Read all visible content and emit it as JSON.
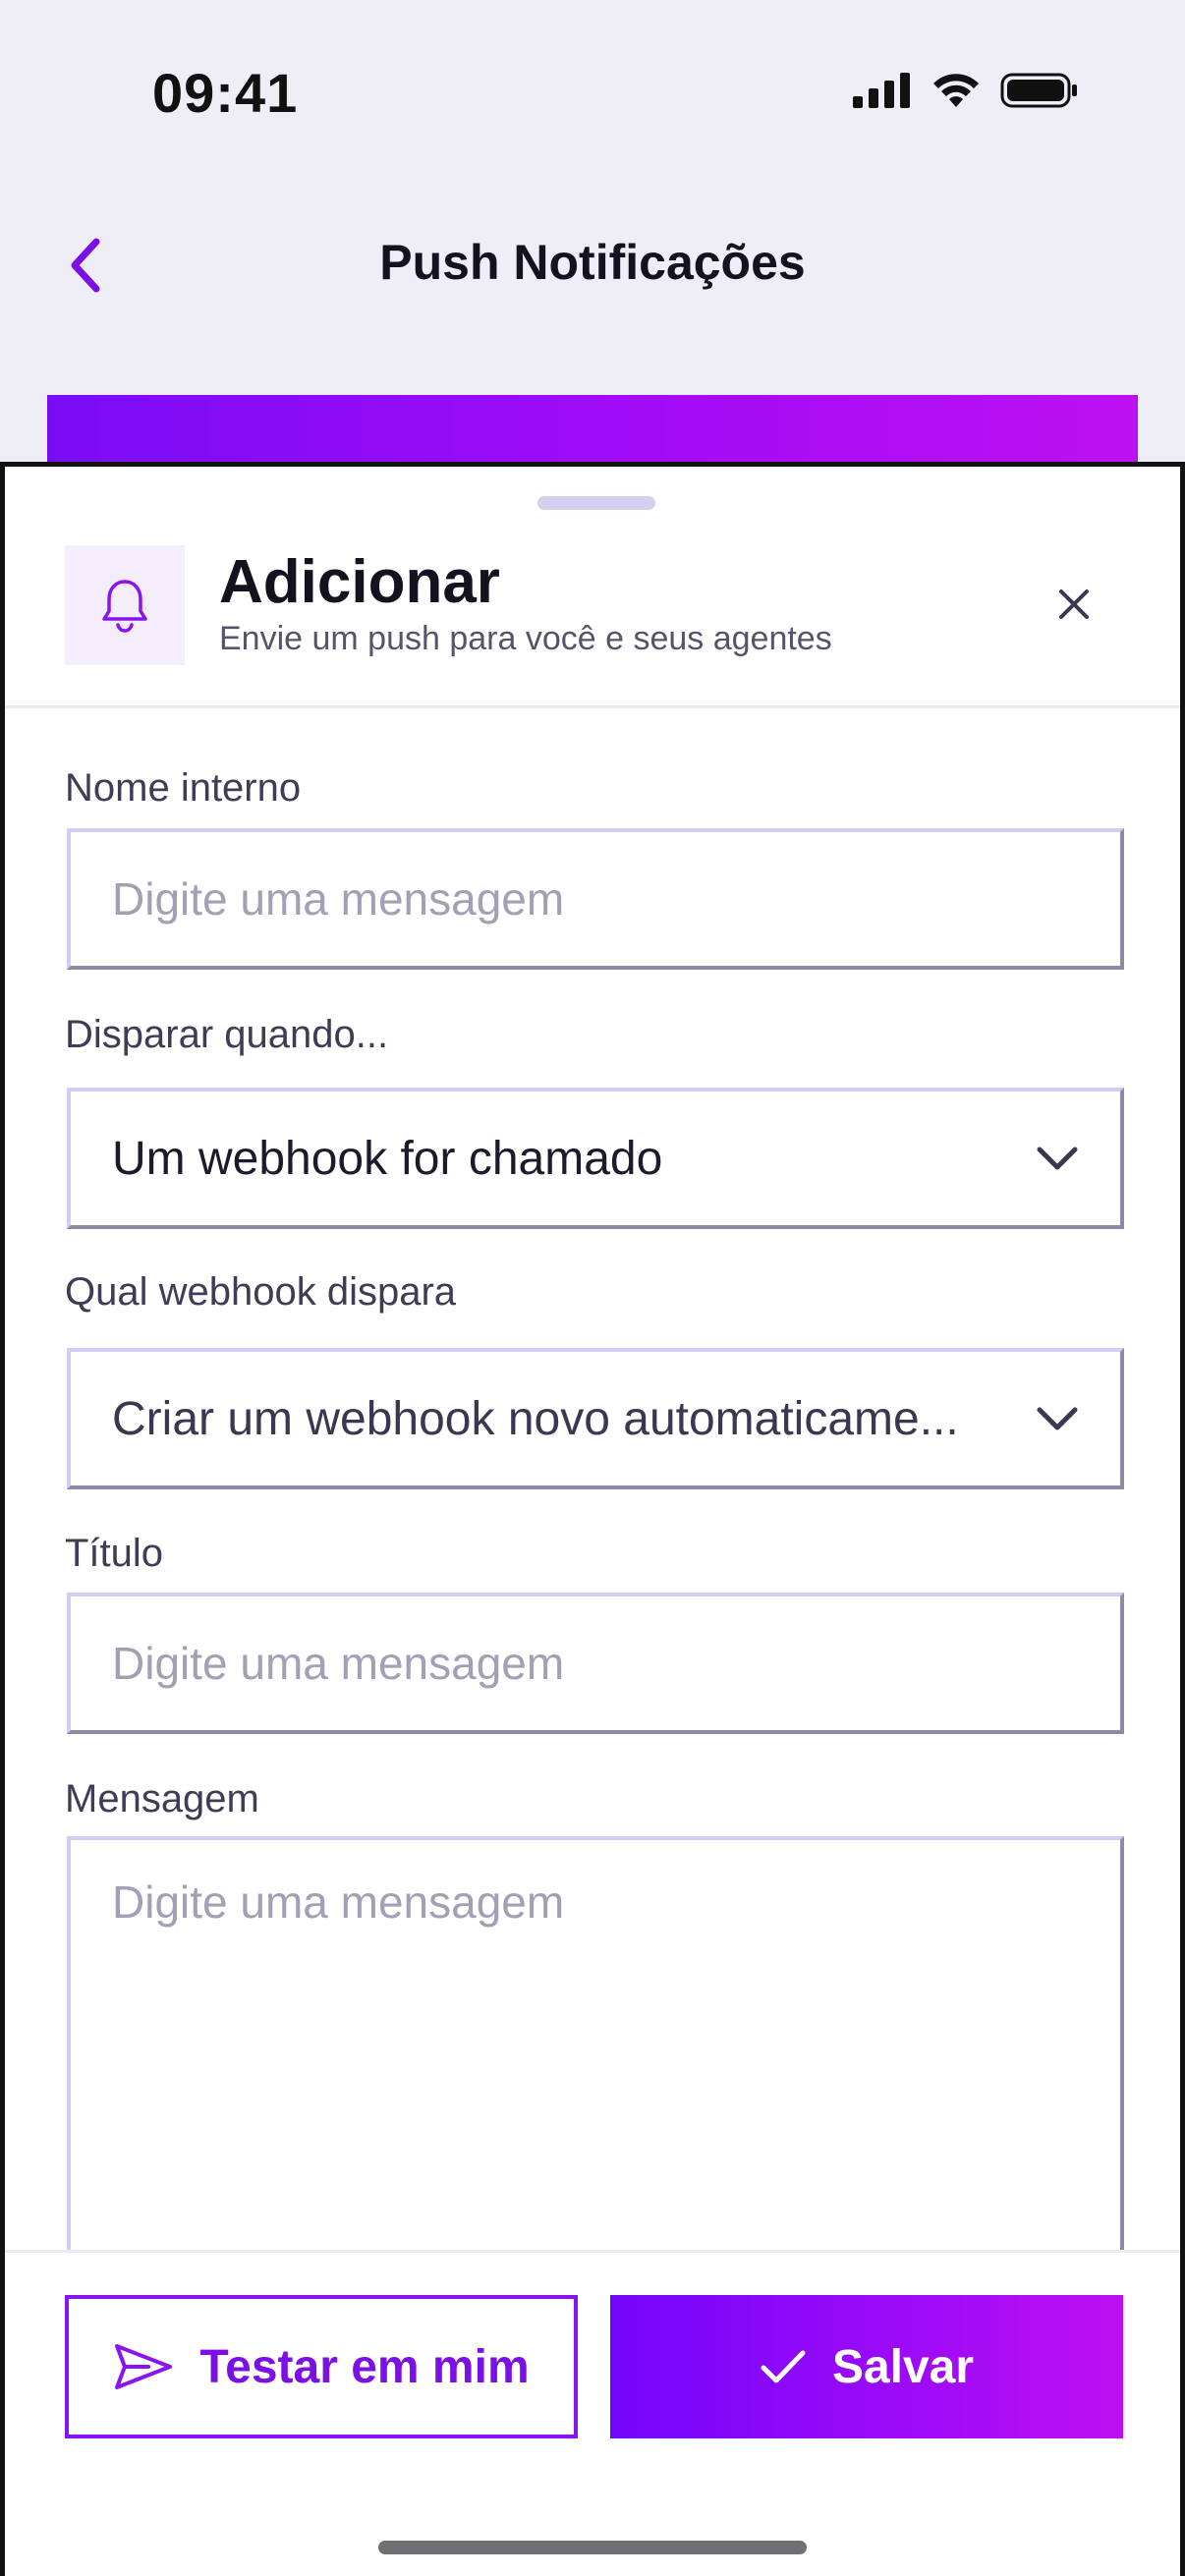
{
  "status_bar": {
    "time": "09:41"
  },
  "nav": {
    "title": "Push Notificações",
    "back_icon": "chevron-left-icon"
  },
  "sheet": {
    "title": "Adicionar",
    "subtitle": "Envie um push para você e seus agentes",
    "header_icon": "bell-icon",
    "close_icon": "close-icon"
  },
  "form": {
    "nome_interno": {
      "label": "Nome interno",
      "placeholder": "Digite uma mensagem",
      "value": ""
    },
    "disparar": {
      "label": "Disparar quando...",
      "value": "Um webhook for chamado"
    },
    "webhook": {
      "label": "Qual webhook dispara",
      "value": "Criar um webhook novo automaticame..."
    },
    "titulo": {
      "label": "Título",
      "placeholder": "Digite uma mensagem",
      "value": ""
    },
    "mensagem": {
      "label": "Mensagem",
      "placeholder": "Digite uma mensagem",
      "value": ""
    }
  },
  "footer": {
    "test_label": "Testar em mim",
    "test_icon": "send-icon",
    "save_label": "Salvar",
    "save_icon": "check-icon"
  },
  "colors": {
    "accent": "#7a10e6",
    "gradient_start": "#7405fb",
    "gradient_end": "#bd10f3",
    "field_border": "#d3ccf5",
    "background": "#efeef6"
  }
}
